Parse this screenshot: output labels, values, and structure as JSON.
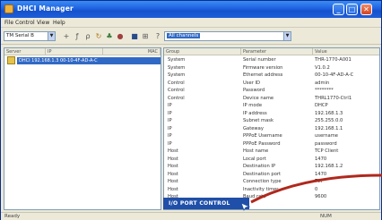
{
  "window": {
    "title": "DHCI Manager"
  },
  "titlebar": {
    "min": "_",
    "max": "□",
    "close": "✕"
  },
  "menu": [
    "File",
    "Control",
    "View",
    "Help"
  ],
  "toolbar": {
    "left_combo": "TM Serial B",
    "right_combo": "All channels"
  },
  "tree": {
    "headers": [
      "Server",
      "IP",
      "MAC"
    ],
    "selected": "DHCI   192.168.1.3   00-10-4F-AD-A-C"
  },
  "list": {
    "headers": [
      "Group",
      "Parameter",
      "Value"
    ],
    "rows": [
      [
        "System",
        "Serial number",
        "THR-1770-A001"
      ],
      [
        "System",
        "Firmware version",
        "V1.0.2"
      ],
      [
        "System",
        "Ethernet address",
        "00-10-4F-AD-A-C"
      ],
      [
        "Control",
        "User ID",
        "admin"
      ],
      [
        "Control",
        "Password",
        "********"
      ],
      [
        "Control",
        "Device name",
        "THRL1770-Ctrl1"
      ],
      [
        "IP",
        "IP mode",
        "DHCP"
      ],
      [
        "IP",
        "IP address",
        "192.168.1.3"
      ],
      [
        "IP",
        "Subnet mask",
        "255.255.0.0"
      ],
      [
        "IP",
        "Gateway",
        "192.168.1.1"
      ],
      [
        "IP",
        "PPPoE Username",
        "username"
      ],
      [
        "IP",
        "PPPoE Password",
        "password"
      ],
      [
        "Host",
        "Host name",
        "TCP Client"
      ],
      [
        "Host",
        "Local port",
        "1470"
      ],
      [
        "Host",
        "Destination IP",
        "192.168.1.2"
      ],
      [
        "Host",
        "Destination port",
        "1470"
      ],
      [
        "Host",
        "Connection type",
        "TCP"
      ],
      [
        "Host",
        "Inactivity timer",
        "0"
      ],
      [
        "Host",
        "Baud rate",
        "9600"
      ]
    ]
  },
  "io_port_label": "I/O PORT CONTROL",
  "statusbar": {
    "text": "Ready",
    "num": "NUM"
  },
  "colors": {
    "title_blue": "#1f62e0",
    "selection": "#316ac5",
    "annotation_red": "#b0281c"
  }
}
